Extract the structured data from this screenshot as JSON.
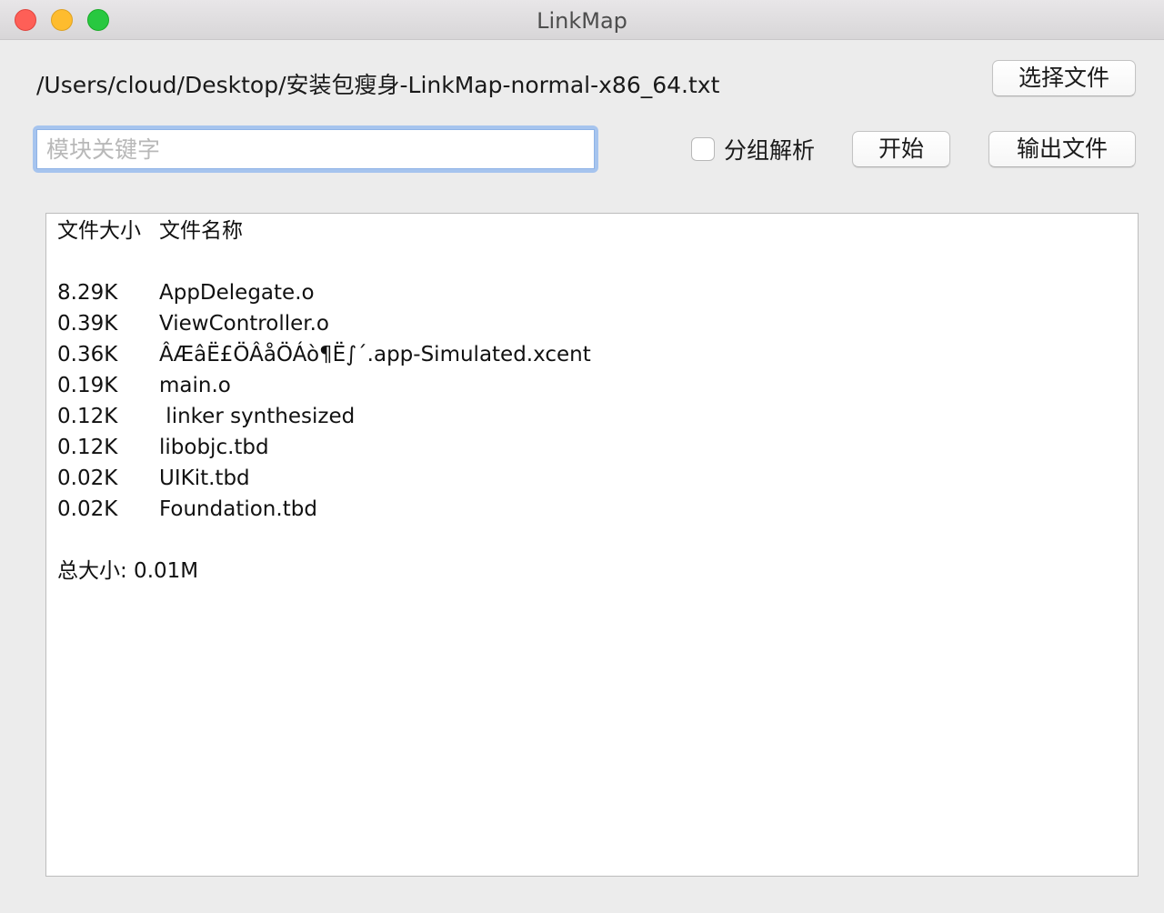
{
  "window": {
    "title": "LinkMap"
  },
  "file_path": "/Users/cloud/Desktop/安装包瘦身-LinkMap-normal-x86_64.txt",
  "buttons": {
    "choose_file": "选择文件",
    "start": "开始",
    "export_file": "输出文件"
  },
  "search": {
    "placeholder": "模块关键字",
    "value": ""
  },
  "group_checkbox": {
    "label": "分组解析",
    "checked": false
  },
  "output": {
    "header": {
      "size": "文件大小",
      "name": "文件名称"
    },
    "rows": [
      {
        "size": "8.29K",
        "name": "AppDelegate.o"
      },
      {
        "size": "0.39K",
        "name": "ViewController.o"
      },
      {
        "size": "0.36K",
        "name": "ÂÆâË£ÖÂåÖÁò¶Ë∫´.app-Simulated.xcent"
      },
      {
        "size": "0.19K",
        "name": "main.o"
      },
      {
        "size": "0.12K",
        "name": " linker synthesized"
      },
      {
        "size": "0.12K",
        "name": "libobjc.tbd"
      },
      {
        "size": "0.02K",
        "name": "UIKit.tbd"
      },
      {
        "size": "0.02K",
        "name": "Foundation.tbd"
      }
    ],
    "total": "总大小: 0.01M"
  }
}
